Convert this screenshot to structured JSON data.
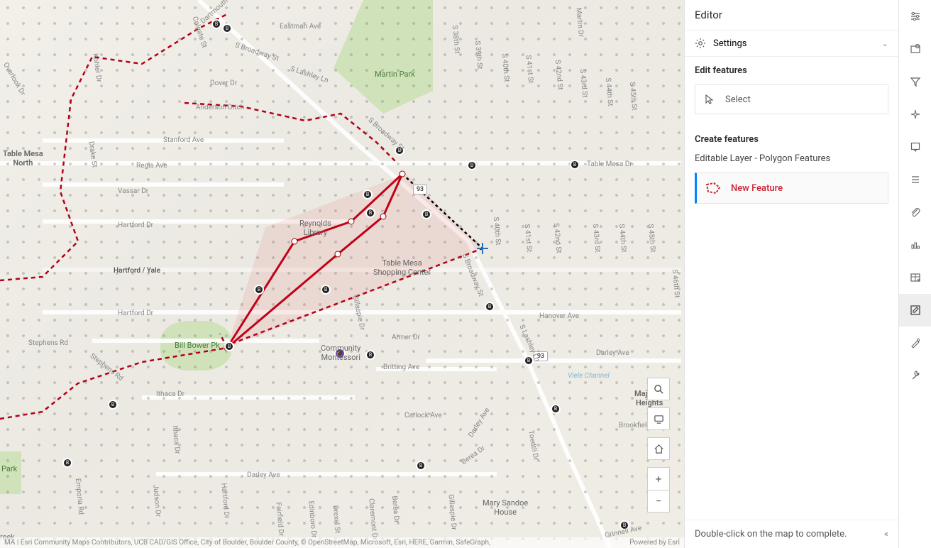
{
  "map": {
    "labels": {
      "broadway": "S Broadway St",
      "lashley": "S Lashley Ln",
      "anderson": "Anderson Ditch",
      "stanford": "Stanford Ave",
      "regis": "Regis Ave",
      "vassar": "Vassar Dr",
      "hartford": "Hartford Dr",
      "hartfordyale": "Hartford / Yale",
      "stephens": "Stephens Rd",
      "ithaca": "Ithaca Dr",
      "darley": "Darley Ave",
      "tablemesa": "Table Mesa Dr",
      "hanover": "Hanover Ave",
      "britting": "Britting Ave",
      "armer": "Armer Dr",
      "carlock": "Carlock Ave",
      "berea": "Berea Dr",
      "colgate": "Colgate St",
      "dartmouth": "Dartmouth Ave",
      "eastman": "Eastman Ave",
      "dover": "Dover Dr",
      "drake": "Drake St",
      "kohler": "Kohler Dr",
      "overlook": "Overlook Dr",
      "gillaspie": "Gillaspie Dr",
      "brookfield": "Brookfield Dr",
      "s38": "S 38th St",
      "s39": "S 39th St",
      "s40": "S 40th St",
      "s41": "S 41st St",
      "s42": "S 42nd St",
      "s43": "S 43rd St",
      "s44": "S 44th St",
      "s45": "S 45th St",
      "s46": "S 46th St",
      "martin": "Martin Dr",
      "judson": "Judson Dr",
      "hartford2": "Hartford Dr",
      "darleyave2": "Darley Ave",
      "toedtli": "Toedtli Dr",
      "field": "Fairfield Dr",
      "drexel": "Drexel St",
      "claremont": "Claremont Dr",
      "edinboro": "Edinboro Dr",
      "grinnell": "Grinnell Ave",
      "emporia": "Emporia Rd",
      "hartford3": "Hartford Dr",
      "viele": "Viele Channel"
    },
    "places": {
      "tablemesa_n": "Table Mesa\nNorth",
      "reynolds": "Reynolds\nLibrary",
      "martinpark": "Martin Park",
      "shopping": "Table Mesa\nShopping Center",
      "bowers": "Bill Bower Pk",
      "montessori": "Community\nMontessori",
      "majestic": "Majestic\nHeights",
      "sandoe": "Mary Sandoe\nHouse",
      "creek": "reek",
      "park2": "Park"
    },
    "route_93": "93",
    "attribution_left": "MA | Esri Community Maps Contributors, UCB CAD/GIS Office, City of Boulder, Boulder County, © OpenStreetMap, Microsoft, Esri, HERE, Garmin, SafeGraph,",
    "attribution_right": "Powered by Esri"
  },
  "editor": {
    "title": "Editor",
    "settings": "Settings",
    "edit_section": "Edit features",
    "select_label": "Select",
    "create_section": "Create features",
    "layer_name": "Editable Layer - Polygon Features",
    "template_label": "New Feature",
    "hint": "Double-click on the map to complete."
  },
  "toolbar": {
    "items": [
      "sliders",
      "layers-extent",
      "filter",
      "sparkle",
      "bookmark",
      "list",
      "link",
      "chart",
      "table",
      "edit",
      "wrench",
      "config"
    ]
  }
}
